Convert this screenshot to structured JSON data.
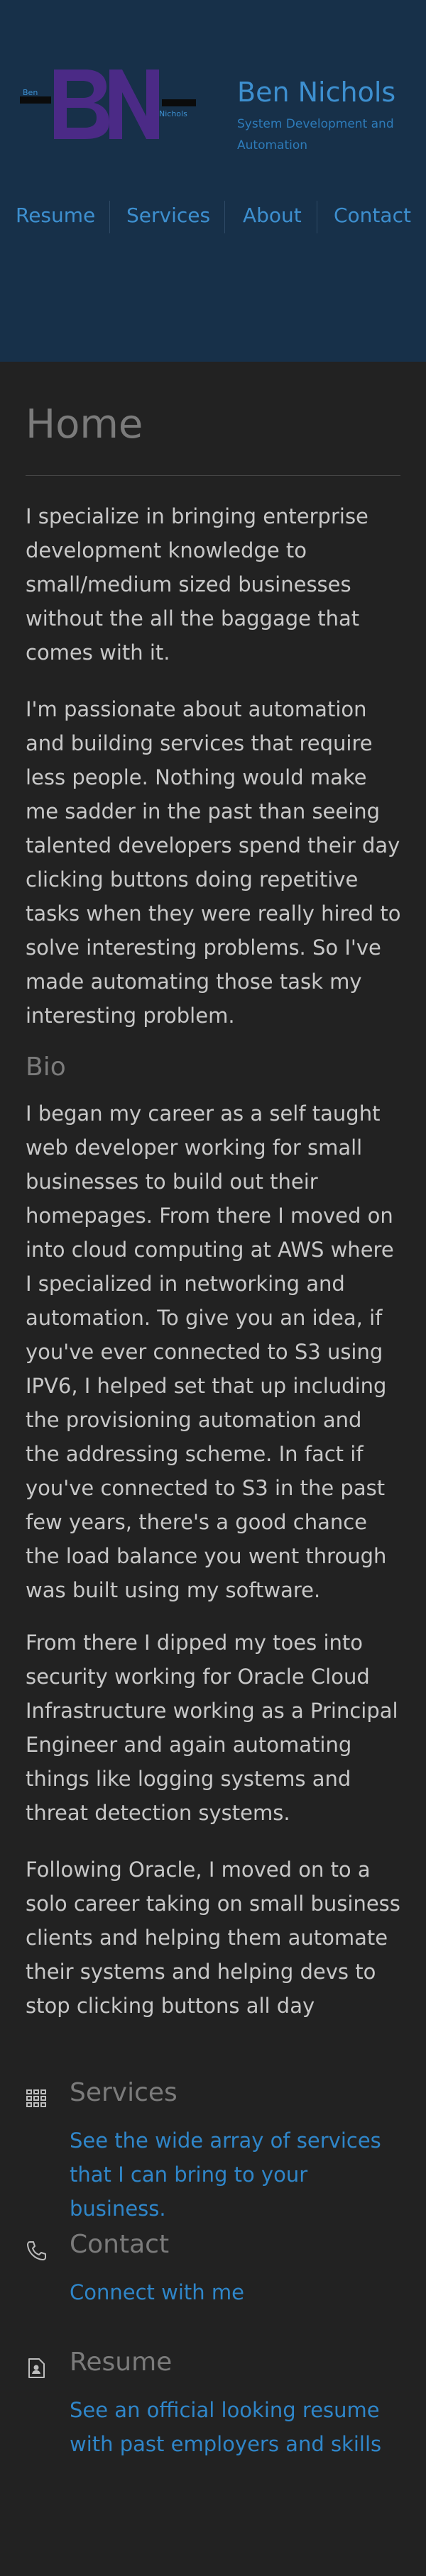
{
  "header": {
    "logo": {
      "letters": "BN",
      "first": "Ben",
      "last": "Nichols"
    },
    "site_name": "Ben Nichols",
    "tagline": "System Development and Automation",
    "nav": [
      {
        "label": "Resume"
      },
      {
        "label": "Services"
      },
      {
        "label": "About"
      },
      {
        "label": "Contact"
      }
    ]
  },
  "main": {
    "title": "Home",
    "intro": [
      "I specialize in bringing enterprise development knowledge to small/medium sized businesses without the all the baggage that comes with it.",
      "I'm passionate about automation and building services that require less people. Nothing would make me sadder in the past than seeing talented developers spend their day clicking buttons doing repetitive tasks when they were really hired to solve interesting problems. So I've made automating those task my interesting problem."
    ],
    "bio_heading": "Bio",
    "bio": [
      "I began my career as a self taught web developer working for small businesses to build out their homepages. From there I moved on into cloud computing at AWS where I specialized in networking and automation. To give you an idea, if you've ever connected to S3 using IPV6, I helped set that up including the provisioning automation and the addressing scheme. In fact if you've connected to S3 in the past few years, there's a good chance the load balance you went through was built using my software.",
      "From there I dipped my toes into security working for Oracle Cloud Infrastructure working as a Principal Engineer and again automating things like logging systems and threat detection systems.",
      "Following Oracle, I moved on to a solo career taking on small business clients and helping them automate their systems and helping devs to stop clicking buttons all day"
    ],
    "links": [
      {
        "title": "Services",
        "description": "See the wide array of services that I can bring to your business.",
        "icon": "grid-icon"
      },
      {
        "title": "Contact",
        "description": "Connect with me",
        "icon": "phone-icon"
      },
      {
        "title": "Resume",
        "description": "See an official looking resume with past employers and skills",
        "icon": "resume-icon"
      }
    ]
  },
  "colors": {
    "header_bg": "#173049",
    "page_bg": "#222222",
    "accent": "#3d8fcf",
    "logo_purple": "#4b2a86"
  }
}
